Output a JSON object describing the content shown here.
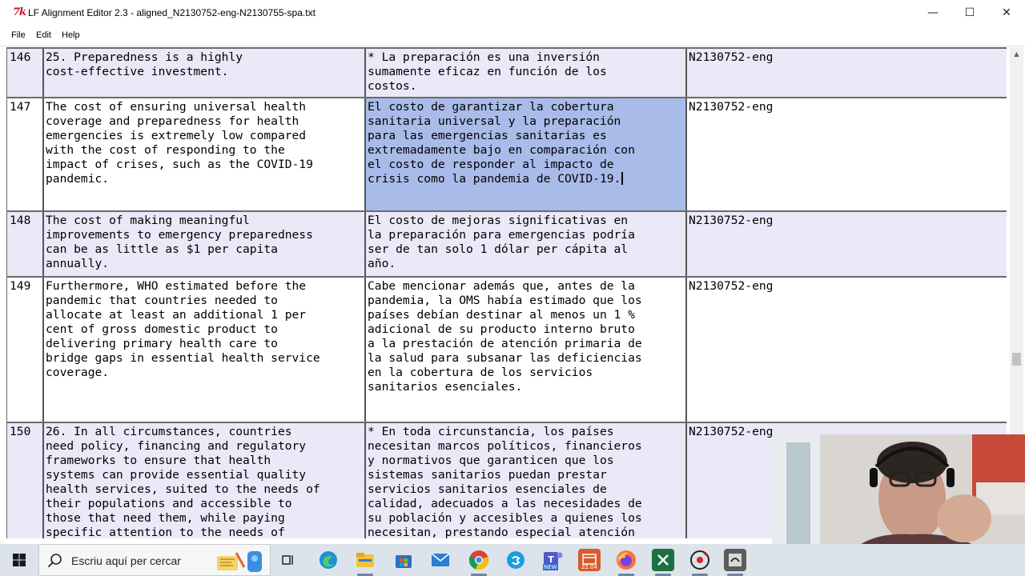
{
  "window": {
    "title": "LF Alignment Editor 2.3 - aligned_N2130752-eng-N2130755-spa.txt",
    "app_icon_text": "7k",
    "controls": {
      "minimize": "—",
      "maximize": "☐",
      "close": "✕"
    }
  },
  "menu": {
    "items": [
      "File",
      "Edit",
      "Help"
    ]
  },
  "table": {
    "rows": [
      {
        "num": "146",
        "en": "25. Preparedness is a highly\ncost-effective investment.",
        "es": "* La preparación es una inversión\nsumamente eficaz en función de los\ncostos.",
        "id": "N2130752-eng"
      },
      {
        "num": "147",
        "en": "The cost of ensuring universal health\ncoverage and preparedness for health\nemergencies is extremely low compared\nwith the cost of responding to the\nimpact of crises, such as the COVID-19\npandemic.",
        "es": "El costo de garantizar la cobertura\nsanitaria universal y la preparación\npara las emergencias sanitarias es\nextremadamente bajo en comparación con\nel costo de responder al impacto de\ncrisis como la pandemia de COVID-19.",
        "id": "N2130752-eng"
      },
      {
        "num": "148",
        "en": "The cost of making meaningful\nimprovements to emergency preparedness\ncan be as little as $1 per capita\nannually.",
        "es": "El costo de mejoras significativas en\nla preparación para emergencias podría\nser de tan solo 1 dólar per cápita al\naño.",
        "id": "N2130752-eng"
      },
      {
        "num": "149",
        "en": "Furthermore, WHO estimated before the\npandemic that countries needed to\nallocate at least an additional 1 per\ncent of gross domestic product to\ndelivering primary health care to\nbridge gaps in essential health service\ncoverage.",
        "es": "Cabe mencionar además que, antes de la\npandemia, la OMS había estimado que los\npaíses debían destinar al menos un 1 %\nadicional de su producto interno bruto\na la prestación de atención primaria de\nla salud para subsanar las deficiencias\nen la cobertura de los servicios\nsanitarios esenciales.",
        "id": "N2130752-eng"
      },
      {
        "num": "150",
        "en": "26. In all circumstances, countries\nneed policy, financing and regulatory\nframeworks to ensure that health\nsystems can provide essential quality\nhealth services, suited to the needs of\ntheir populations and accessible to\nthose that need them, while paying\nspecific attention to the needs of",
        "es": "* En toda circunstancia, los países\nnecesitan marcos políticos, financieros\ny normativos que garanticen que los\nsistemas sanitarios puedan prestar\nservicios sanitarios esenciales de\ncalidad, adecuados a las necesidades de\nsu población y accesibles a quienes los\nnecesitan, prestando especial atención",
        "id": "N2130752-eng"
      }
    ],
    "selected_row": "147"
  },
  "taskbar": {
    "search_placeholder": "Escriu aquí per cercar",
    "apps": [
      "task-view-icon",
      "edge-icon",
      "file-explorer-icon",
      "store-icon",
      "mail-icon",
      "chrome-icon",
      "skype-icon",
      "teams-icon",
      "calendar-app-icon",
      "firefox-icon",
      "excel-app-icon",
      "recorder-icon",
      "tk-app-icon"
    ],
    "teams_badge": "NEW",
    "calendar_badge": "22.04"
  },
  "colors": {
    "row_alt_bg": "#e9e9f8",
    "selection_bg": "#a9bbe9",
    "grid_line": "#6b6b6b",
    "taskbar_bg": "#dde3ea"
  }
}
